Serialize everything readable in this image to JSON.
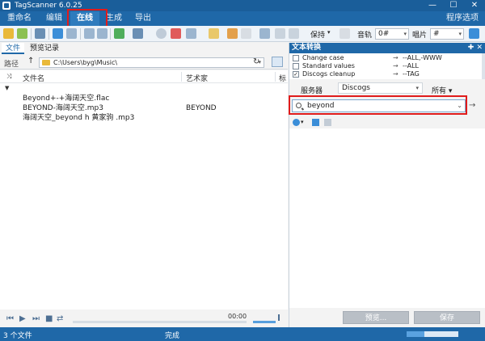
{
  "window": {
    "title": "TagScanner 6.0.25",
    "controls": {
      "minimize": "—",
      "maximize": "☐",
      "close": "✕"
    }
  },
  "menu": {
    "items": [
      {
        "label": "重命名"
      },
      {
        "label": "编辑"
      },
      {
        "label": "在线"
      },
      {
        "label": "生成"
      },
      {
        "label": "导出"
      }
    ],
    "active": "在线",
    "program_options": "程序选项"
  },
  "toolbar": {
    "save_label": "保持",
    "track_label": "音轨",
    "track_value": "0#",
    "disc_label": "唱片",
    "disc_value": "#"
  },
  "left_panel": {
    "tabs": [
      {
        "label": "文件"
      },
      {
        "label": "预览记录"
      }
    ],
    "path_label": "路径",
    "path_value": "C:\\Users\\byg\\Music\\",
    "columns": {
      "filename": "文件名",
      "artist": "艺术家",
      "extra": "标"
    },
    "files": [
      {
        "name": "Beyond+-+海阔天空.flac",
        "artist": ""
      },
      {
        "name": "BEYOND-海阔天空.mp3",
        "artist": "BEYOND"
      },
      {
        "name": "海阔天空_beyond h 黄家驹 .mp3",
        "artist": ""
      }
    ]
  },
  "player": {
    "time": "00:00",
    "volume_fraction": 0.85
  },
  "right_panel": {
    "header": "文本转换",
    "conversions": [
      {
        "checked": false,
        "name": "Change case",
        "target": "--ALL,-WWW"
      },
      {
        "checked": false,
        "name": "Standard values",
        "target": "--ALL"
      },
      {
        "checked": true,
        "name": "Discogs cleanup",
        "target": "--TAG"
      }
    ],
    "server_label": "服务器",
    "server_value": "Discogs",
    "scope_value": "所有",
    "search_value": "beyond",
    "preview_button": "预览...",
    "save_button": "保存"
  },
  "status": {
    "file_count": "3 个文件",
    "state": "完成",
    "progress_fraction": 0.35
  },
  "colors": {
    "title_bar": "#1a5e9a",
    "menu_bar": "#1f68a8",
    "highlight_box": "#e01b1b",
    "accent": "#3b8ed8"
  }
}
